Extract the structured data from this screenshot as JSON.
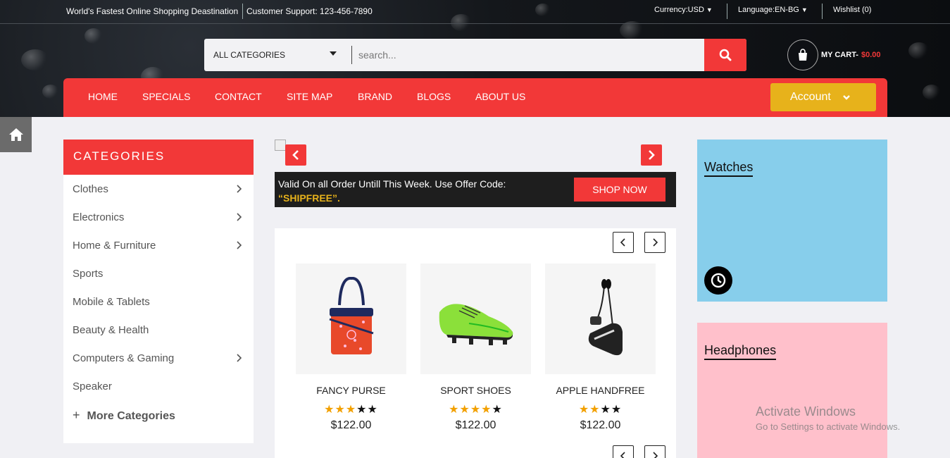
{
  "topbar": {
    "tagline": "World's Fastest Online Shopping Deastination",
    "support": "Customer Support: 123-456-7890",
    "currency": "Currency:USD",
    "language": "Language:EN-BG",
    "wishlist": "Wishlist (0)"
  },
  "search": {
    "category": "ALL CATEGORIES",
    "placeholder": "search..."
  },
  "cart": {
    "label": "MY CART-",
    "total": "$0.00"
  },
  "nav": {
    "links": [
      "HOME",
      "SPECIALS",
      "CONTACT",
      "SITE MAP",
      "BRAND",
      "BLOGS",
      "ABOUT US"
    ],
    "account": "Account"
  },
  "categories": {
    "title": "CATEGORIES",
    "items": [
      {
        "label": "Clothes",
        "has_sub": true
      },
      {
        "label": "Electronics",
        "has_sub": true
      },
      {
        "label": "Home & Furniture",
        "has_sub": true
      },
      {
        "label": "Sports",
        "has_sub": false
      },
      {
        "label": "Mobile & Tablets",
        "has_sub": false
      },
      {
        "label": "Beauty & Health",
        "has_sub": false
      },
      {
        "label": "Computers & Gaming",
        "has_sub": true
      },
      {
        "label": "Speaker",
        "has_sub": false
      }
    ],
    "more": "More Categories"
  },
  "offer": {
    "text": "Valid On all Order Untill This Week. Use Offer Code:",
    "code": "“SHIPFREE”.",
    "button": "SHOP NOW"
  },
  "products": [
    {
      "name": "FANCY PURSE",
      "rating": 3,
      "max": 5,
      "price": "$122.00"
    },
    {
      "name": "SPORT SHOES",
      "rating": 4,
      "max": 5,
      "price": "$122.00"
    },
    {
      "name": "APPLE HANDFREE",
      "rating": 2,
      "max": 4,
      "price": "$122.00"
    }
  ],
  "banners": {
    "watches": "Watches",
    "headphones": "Headphones"
  },
  "watermark": {
    "line1": "Activate Windows",
    "line2": "Go to Settings to activate Windows."
  },
  "colors": {
    "brand_red": "#f23838",
    "account_yellow": "#e7b21b",
    "watches_bg": "#87ceeb",
    "headphones_bg": "#ffc0cb"
  }
}
